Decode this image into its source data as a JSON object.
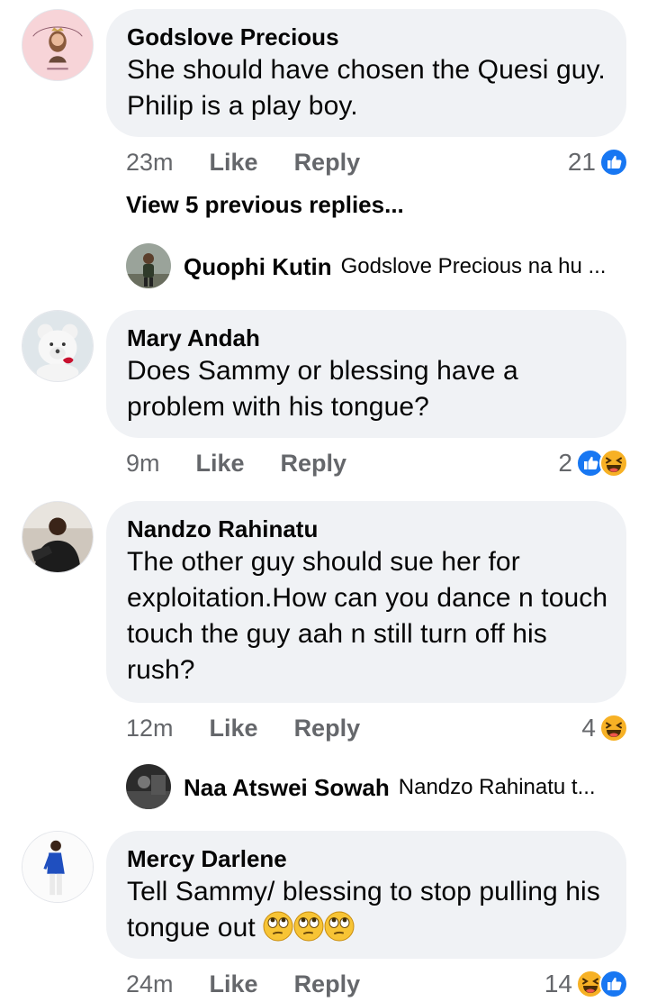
{
  "comments": [
    {
      "author": "Godslove Precious",
      "text": "She should have chosen the Quesi guy. Philip is a play boy.",
      "time": "23m",
      "like": "Like",
      "reply": "Reply",
      "reaction_count": "21",
      "reactions": [
        "like-icon"
      ],
      "view_previous": "View 5 previous replies...",
      "reply_preview": {
        "name": "Quophi Kutin",
        "text": "Godslove Precious na hu ..."
      }
    },
    {
      "author": "Mary Andah",
      "text": "Does Sammy or blessing have a problem with his tongue?",
      "time": "9m",
      "like": "Like",
      "reply": "Reply",
      "reaction_count": "2",
      "reactions": [
        "like-icon",
        "haha-icon"
      ]
    },
    {
      "author": "Nandzo Rahinatu",
      "text": "The other guy should sue her for exploitation.How can you dance n touch touch the guy aah n still turn off his rush?",
      "time": "12m",
      "like": "Like",
      "reply": "Reply",
      "reaction_count": "4",
      "reactions": [
        "haha-icon"
      ],
      "reply_preview": {
        "name": "Naa Atswei Sowah",
        "text": "Nandzo Rahinatu t..."
      }
    },
    {
      "author": "Mercy Darlene",
      "text": "Tell Sammy/ blessing to stop pulling his tongue out",
      "text_emojis": [
        "eye-roll-emoji",
        "eye-roll-emoji",
        "eye-roll-emoji"
      ],
      "time": "24m",
      "like": "Like",
      "reply": "Reply",
      "reaction_count": "14",
      "reactions": [
        "haha-icon",
        "like-icon"
      ]
    }
  ],
  "colors": {
    "bubble": "#f0f2f5",
    "meta": "#65676b",
    "like_blue": "#1877f2",
    "haha_yellow": "#f7b125"
  }
}
